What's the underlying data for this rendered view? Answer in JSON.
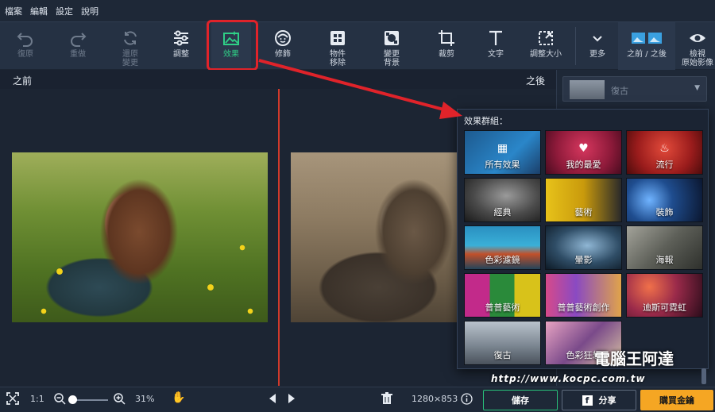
{
  "menu": [
    "檔案",
    "編輯",
    "設定",
    "說明"
  ],
  "toolbar": {
    "undo": "復原",
    "redo": "重做",
    "revert_line1": "還原",
    "revert_line2": "變更",
    "adjust": "調整",
    "effects": "效果",
    "retouch": "修飾",
    "object_removal_line1": "物件",
    "object_removal_line2": "移除",
    "change_bg_line1": "變更",
    "change_bg_line2": "背景",
    "crop": "裁剪",
    "text": "文字",
    "resize": "調整大小",
    "more": "更多",
    "before_after": "之前 / 之後",
    "view_original_line1": "檢視",
    "view_original_line2": "原始影像"
  },
  "canvas": {
    "before_label": "之前",
    "after_label": "之後"
  },
  "preset": {
    "label": "復古"
  },
  "popup": {
    "title": "效果群組：",
    "tiles": [
      {
        "name": "所有效果",
        "icon": "grid-icon"
      },
      {
        "name": "我的最愛",
        "icon": "heart-icon"
      },
      {
        "name": "流行",
        "icon": "flame-icon"
      },
      {
        "name": "經典",
        "icon": ""
      },
      {
        "name": "藝術",
        "icon": ""
      },
      {
        "name": "裝飾",
        "icon": ""
      },
      {
        "name": "色彩濾鏡",
        "icon": ""
      },
      {
        "name": "暈影",
        "icon": ""
      },
      {
        "name": "海報",
        "icon": ""
      },
      {
        "name": "普普藝術",
        "icon": ""
      },
      {
        "name": "普普藝術創作",
        "icon": ""
      },
      {
        "name": "迪斯可霓虹",
        "icon": ""
      },
      {
        "name": "復古",
        "icon": ""
      },
      {
        "name": "色彩狂想",
        "icon": ""
      }
    ]
  },
  "watermark": "http://www.kocpc.com.tw",
  "watermark_logo": "電腦王阿達",
  "bottombar": {
    "ratio": "1:1",
    "zoom": "31%",
    "dimensions": "1280×853",
    "save": "儲存",
    "share": "分享",
    "buy": "購買金鑰"
  },
  "colors": {
    "accent_green": "#28c07a",
    "highlight_red": "#e0232a",
    "buy_orange": "#f5a623",
    "divider_red": "#d23a2b"
  }
}
